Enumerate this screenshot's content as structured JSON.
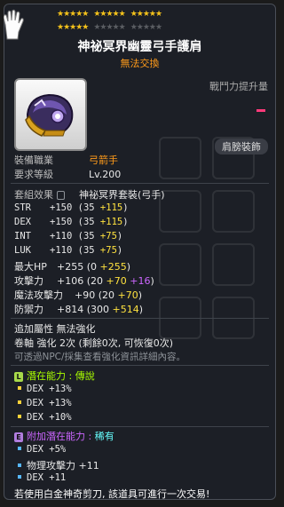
{
  "stars": {
    "row1": [
      "★★★★★",
      "★★★★★",
      "★★★★★"
    ],
    "row2_on": "★★★★★",
    "row2_off": [
      "★★★★★",
      "★★★★★"
    ]
  },
  "item": {
    "name": "神祕冥界幽靈弓手護肩",
    "subtitle": "無法交換"
  },
  "power_label": "戰鬥力提升量",
  "slot_button": "肩膀裝飾",
  "job": {
    "label": "裝備職業",
    "value": "弓箭手"
  },
  "level": {
    "label": "要求等級",
    "value": "Lv.200"
  },
  "set": {
    "label": "套組效果",
    "value": "神祕冥界套裝(弓手)"
  },
  "stats": [
    {
      "name": "STR",
      "total": "+150",
      "open": "(35",
      "bonus": "+115",
      "close": ")"
    },
    {
      "name": "DEX",
      "total": "+150",
      "open": "(35",
      "bonus": "+115",
      "close": ")"
    },
    {
      "name": "INT",
      "total": "+110",
      "open": "(35",
      "bonus": "+75",
      "close": ")"
    },
    {
      "name": "LUK",
      "total": "+110",
      "open": "(35",
      "bonus": "+75",
      "close": ")"
    }
  ],
  "stats2": [
    {
      "name": "最大HP",
      "total": "+255",
      "open": "(0",
      "bonus": "+255",
      "close": ")"
    },
    {
      "name": "攻擊力",
      "total": "+106",
      "open": "(20",
      "bonus": "+70",
      "extra": "+16",
      "close": ")"
    },
    {
      "name": "魔法攻擊力",
      "total": "+90",
      "open": "(20",
      "bonus": "+70",
      "close": ")"
    },
    {
      "name": "防禦力",
      "total": "+814",
      "open": "(300",
      "bonus": "+514",
      "close": ")"
    }
  ],
  "extra_prop": {
    "label": "追加屬性",
    "value": "無法強化"
  },
  "scroll": {
    "label": "卷軸 強化",
    "value": "2次 (剩餘0次, 可恢復0次)"
  },
  "npc_note": "可透過NPC/採集查看強化資訊詳細內容。",
  "potential": {
    "tag": "L",
    "label": "潛在能力 :",
    "grade": "傳說",
    "lines": [
      "DEX +13%",
      "DEX +13%",
      "DEX +10%"
    ]
  },
  "addi_potential": {
    "tag": "E",
    "label": "附加潛在能力 :",
    "grade": "稀有",
    "lines": [
      "DEX +5%",
      "物理攻擊力 +11",
      "DEX +11"
    ]
  },
  "footer": "若使用白金神奇剪刀, 該道具可進行一次交易!"
}
